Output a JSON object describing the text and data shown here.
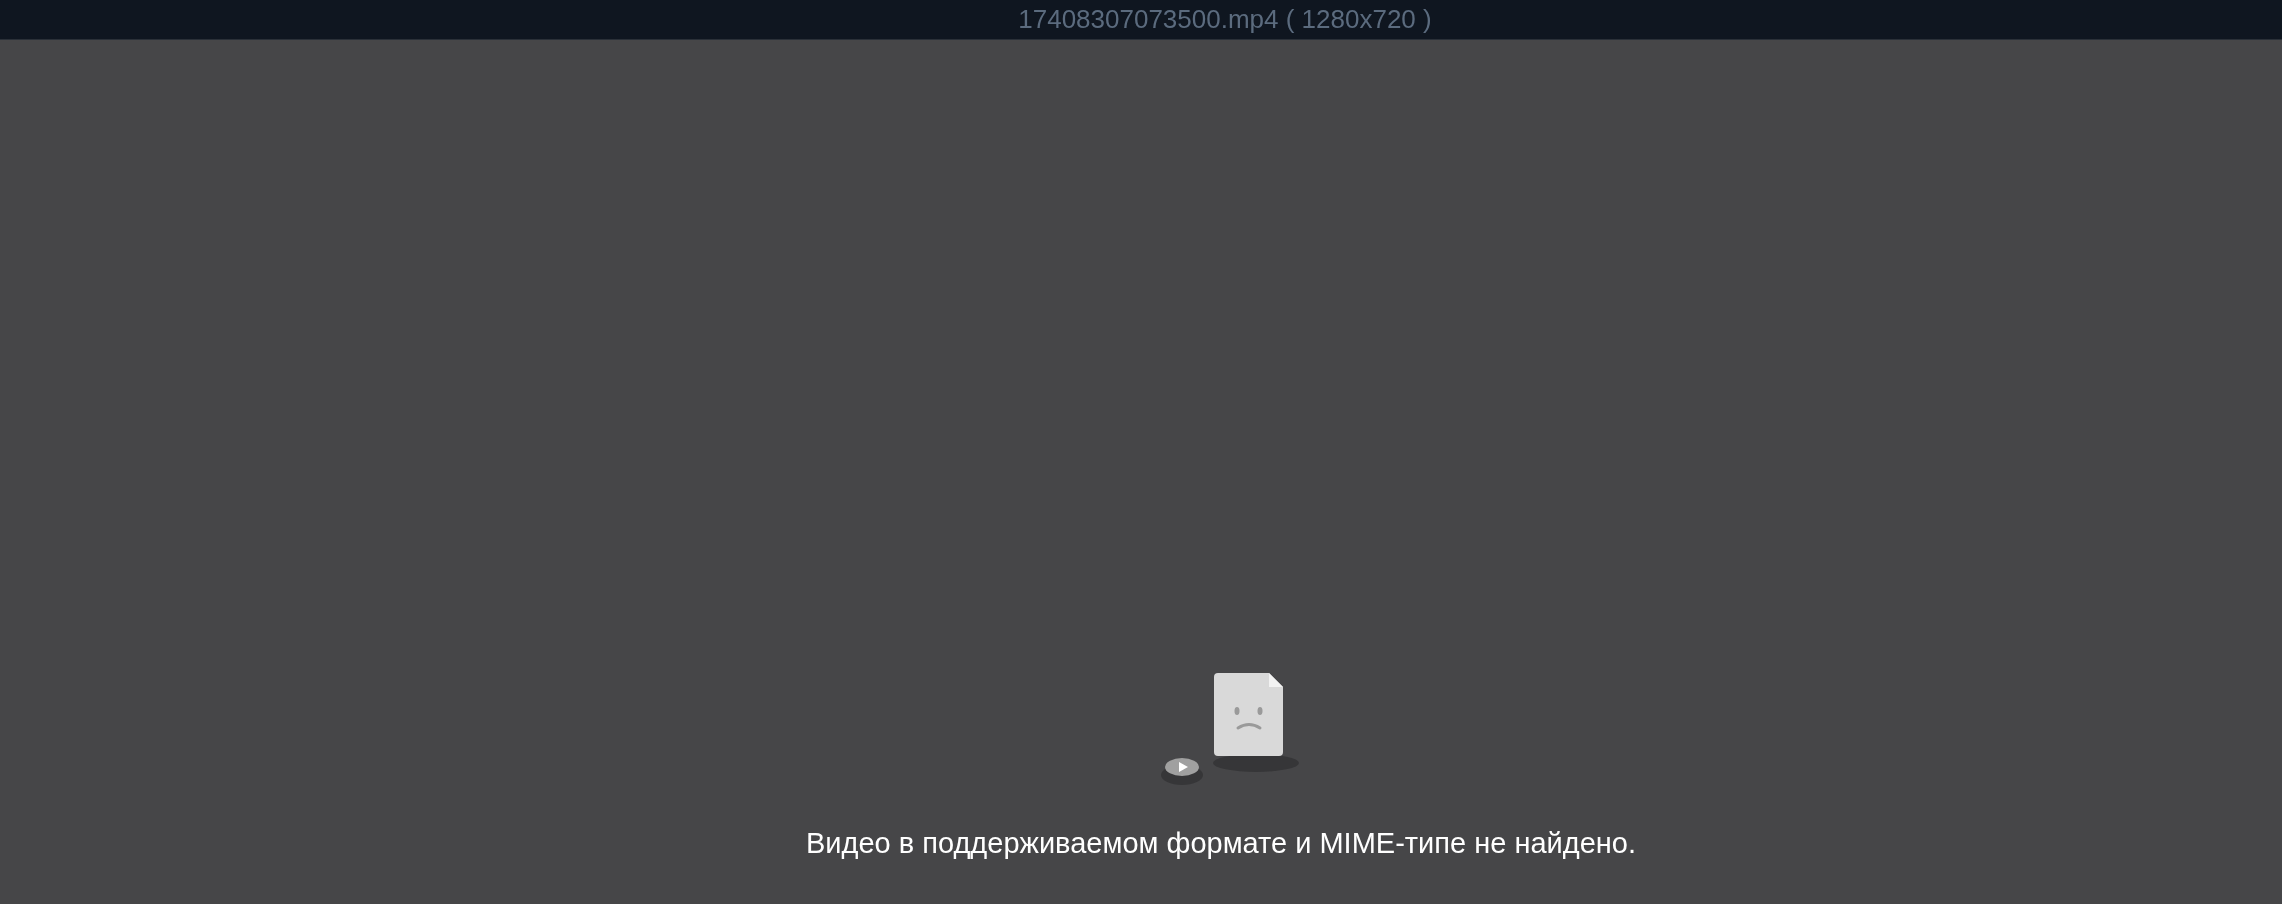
{
  "title_bar": {
    "title": "17408307073500.mp4 ( 1280x720 )"
  },
  "player": {
    "message": "Видео в поддерживаемом формате и MIME-типе не найдено."
  }
}
